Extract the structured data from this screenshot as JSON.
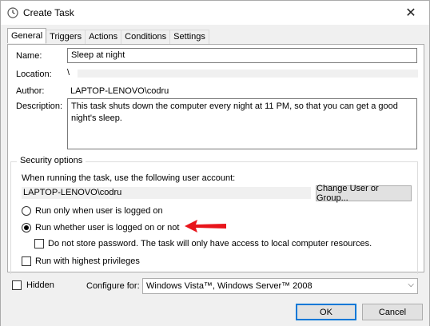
{
  "window": {
    "title": "Create Task",
    "close_glyph": "✕"
  },
  "tabs": [
    {
      "label": "General"
    },
    {
      "label": "Triggers"
    },
    {
      "label": "Actions"
    },
    {
      "label": "Conditions"
    },
    {
      "label": "Settings"
    }
  ],
  "general": {
    "name_label": "Name:",
    "name_value": "Sleep at night",
    "location_label": "Location:",
    "location_value": "\\",
    "author_label": "Author:",
    "author_value": "LAPTOP-LENOVO\\codru",
    "description_label": "Description:",
    "description_value": "This task shuts down the computer every night at 11 PM, so that you can get a good night's sleep."
  },
  "security": {
    "group_title": "Security options",
    "account_prompt": "When running the task, use the following user account:",
    "account_value": "LAPTOP-LENOVO\\codru",
    "change_button": "Change User or Group...",
    "radio_logged_on": "Run only when user is logged on",
    "radio_whether": "Run whether user is logged on or not",
    "do_not_store_prefix": "Do not store password.",
    "do_not_store_suffix": " The task will only have access to local computer resources.",
    "highest_privileges": "Run with highest privileges"
  },
  "footer": {
    "hidden_label": "Hidden",
    "configure_label": "Configure for:",
    "configure_value": "Windows Vista™, Windows Server™ 2008",
    "ok_button": "OK",
    "cancel_button": "Cancel"
  },
  "colors": {
    "arrow": "#e8151b",
    "accent": "#0078d7"
  }
}
